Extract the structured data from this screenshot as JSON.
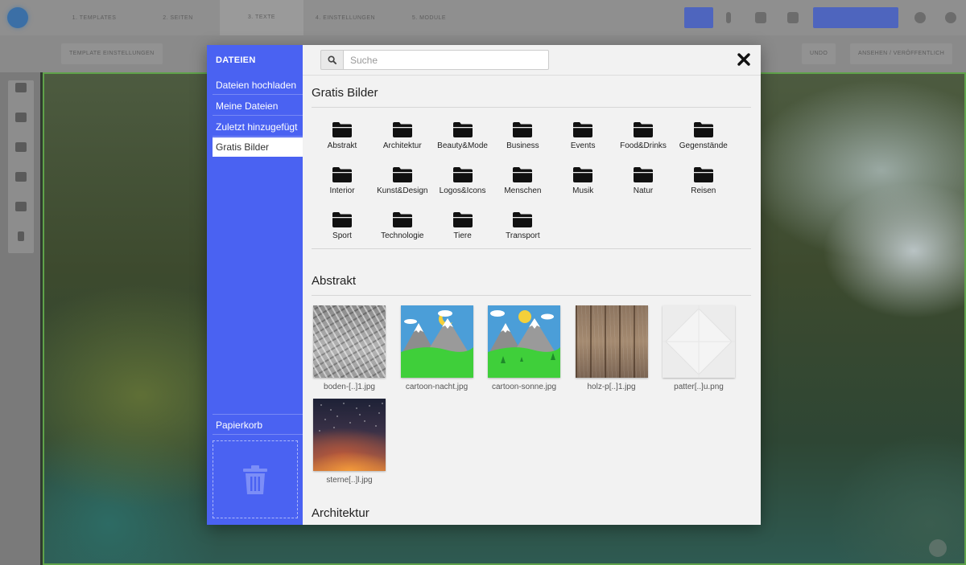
{
  "background": {
    "steps": [
      "1. TEMPLATES",
      "2. SEITEN",
      "3. TEXTE",
      "4. EINSTELLUNGEN",
      "5. MODULE"
    ],
    "active_step": 2,
    "subbar_left": "TEMPLATE EINSTELLUNGEN",
    "subbar_right": [
      "UNDO",
      "ANSEHEN / VERÖFFENTLICH"
    ]
  },
  "modal": {
    "sidebar": {
      "title": "DATEIEN",
      "items": [
        {
          "label": "Dateien hochladen",
          "active": false
        },
        {
          "label": "Meine Dateien",
          "active": false
        },
        {
          "label": "Zuletzt hinzugefügt",
          "active": false
        },
        {
          "label": "Gratis Bilder",
          "active": true
        }
      ],
      "trash_label": "Papierkorb",
      "accent": "#4a62f2"
    },
    "search": {
      "placeholder": "Suche",
      "value": ""
    },
    "sections": {
      "free_images_title": "Gratis Bilder",
      "categories": [
        "Abstrakt",
        "Architektur",
        "Beauty&Mode",
        "Business",
        "Events",
        "Food&Drinks",
        "Gegenstände",
        "Interior",
        "Kunst&Design",
        "Logos&Icons",
        "Menschen",
        "Musik",
        "Natur",
        "Reisen",
        "Sport",
        "Technologie",
        "Tiere",
        "Transport"
      ],
      "abstract_title": "Abstrakt",
      "images": [
        {
          "label": "boden-[..]1.jpg",
          "kind": "boden"
        },
        {
          "label": "cartoon-nacht.jpg",
          "kind": "cartoon-night"
        },
        {
          "label": "cartoon-sonne.jpg",
          "kind": "cartoon-sun"
        },
        {
          "label": "holz-p[..]1.jpg",
          "kind": "holz"
        },
        {
          "label": "patter[..]u.png",
          "kind": "pattern"
        },
        {
          "label": "sterne[..]l.jpg",
          "kind": "sterne"
        }
      ],
      "architecture_title": "Architektur"
    }
  }
}
